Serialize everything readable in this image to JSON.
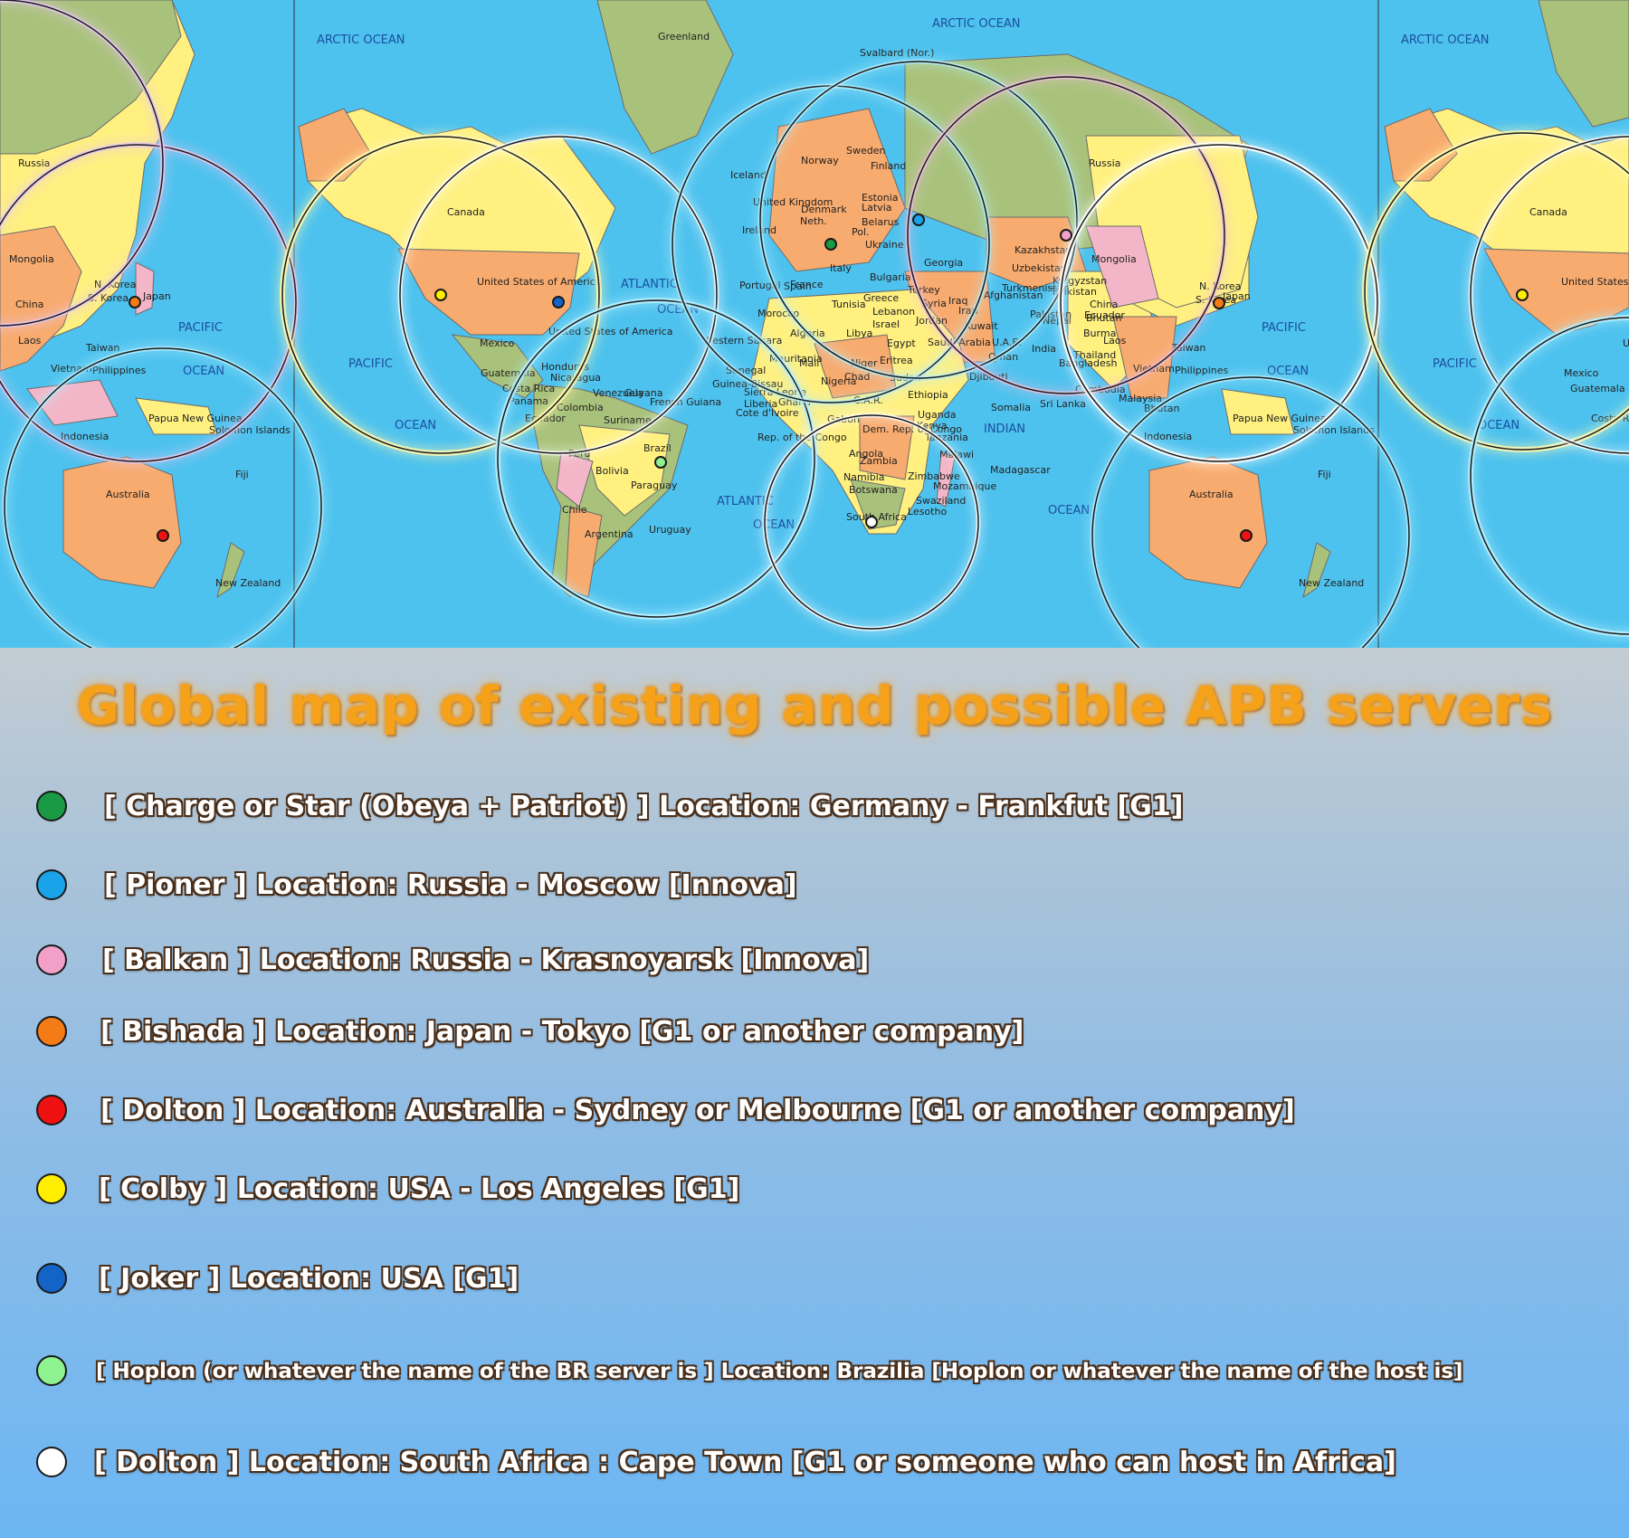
{
  "title": "Global map of existing and possible APB servers",
  "colors": {
    "ocean": "#4ec2ee",
    "land_green": "#a9c27b",
    "land_yellow": "#fff080",
    "land_orange": "#f8ab6e",
    "land_pink": "#f3b6c8",
    "range_ring": "#1a1a1a",
    "title": "#f5a21a"
  },
  "map": {
    "ocean_labels": [
      "ARCTIC OCEAN",
      "ARCTIC OCEAN",
      "ARCTIC OCEAN",
      "PACIFIC",
      "OCEAN",
      "PACIFIC",
      "OCEAN",
      "ATLANTIC",
      "OCEAN",
      "ATLANTIC",
      "OCEAN",
      "INDIAN",
      "OCEAN",
      "PACIFIC",
      "OCEAN",
      "PACIFIC",
      "OCEAN"
    ],
    "country_labels": [
      "Greenland",
      "Svalbard (Nor.)",
      "Russia",
      "Russia",
      "Mongolia",
      "China",
      "N. Korea",
      "S. Korea",
      "Japan",
      "Taiwan",
      "Laos",
      "Vietnam",
      "Philippines",
      "Papua New Guinea",
      "Solomon Islands",
      "Indonesia",
      "Australia",
      "New Zealand",
      "Fiji",
      "United States of America",
      "Canada",
      "United States of America",
      "Mexico",
      "Guatemala",
      "Honduras",
      "Nicaragua",
      "Costa Rica",
      "Panama",
      "Ecuador",
      "Colombia",
      "Venezuela",
      "Guyana",
      "Suriname",
      "French Guiana",
      "Peru",
      "Brazil",
      "Bolivia",
      "Paraguay",
      "Chile",
      "Argentina",
      "Uruguay",
      "Iceland",
      "United Kingdom",
      "Ireland",
      "Norway",
      "Sweden",
      "Finland",
      "Denmark",
      "Neth.",
      "Pol.",
      "Estonia",
      "Latvia",
      "Belarus",
      "Ukraine",
      "France",
      "Spain",
      "Portugal",
      "Italy",
      "Morocco",
      "Algeria",
      "Tunisia",
      "Libya",
      "Egypt",
      "Greece",
      "Bulgaria",
      "Turkey",
      "Georgia",
      "Syria",
      "Israel",
      "Lebanon",
      "Jordan",
      "Iraq",
      "Iran",
      "Kuwait",
      "Saudi Arabia",
      "U.A.E.",
      "Oman",
      "Eritrea",
      "Djibouti",
      "Sudan",
      "Ethiopia",
      "Somalia",
      "Kenya",
      "Uganda",
      "Tanzania",
      "Malawi",
      "Zambia",
      "Angola",
      "Namibia",
      "Botswana",
      "Zimbabwe",
      "Mozambique",
      "Swaziland",
      "Lesotho",
      "South Africa",
      "Madagascar",
      "Dem. Rep. of Congo",
      "Gabon",
      "C.A.R.",
      "Chad",
      "Niger",
      "Nigeria",
      "Mali",
      "Mauritania",
      "Western Sahara",
      "Senegal",
      "Guinea-Bissau",
      "Sierra Leone",
      "Liberia",
      "Cote d'Ivoire",
      "Ghana",
      "Rep. of the Congo",
      "Kazakhstan",
      "Kyrgyzstan",
      "Tajikistan",
      "Uzbekistan",
      "Turkmenistan",
      "Afghanistan",
      "Pakistan",
      "India",
      "Nepal",
      "Bangladesh",
      "Bhutan",
      "Burma",
      "Thailand",
      "Cambodia",
      "Malaysia",
      "Sri Lanka",
      "Mongolia",
      "China",
      "N. Korea",
      "S. Korea",
      "Japan",
      "Taiwan",
      "Laos",
      "Vietnam",
      "Philippines",
      "Papua New Guinea",
      "Solomon Islands",
      "Indonesia",
      "Australia",
      "New Zealand",
      "Fiji",
      "United States of America",
      "Canada",
      "United States of America",
      "Mexico",
      "Guatemala",
      "Costa Rica",
      "Ecuador",
      "Bhutan",
      "Malaysia"
    ]
  },
  "servers": [
    {
      "color": "#1a9a45",
      "label": "[ Charge or Star (Obeya + Patriot) ] Location: Germany - Frankfut [G1]"
    },
    {
      "color": "#1aa3e8",
      "label": "[ Pioner ] Location:  Russia - Moscow [Innova]"
    },
    {
      "color": "#f2a0c8",
      "label": "[ Balkan ] Location:  Russia - Krasnoyarsk [Innova]"
    },
    {
      "color": "#f47b16",
      "label": "[ Bishada ] Location:  Japan - Tokyo [G1 or another company]"
    },
    {
      "color": "#ee1111",
      "label": "[ Dolton ] Location:  Australia - Sydney or  Melbourne [G1 or another company]"
    },
    {
      "color": "#ffee00",
      "label": "[ Colby ] Location:  USA - Los Angeles [G1]"
    },
    {
      "color": "#1464c8",
      "label": "[ Joker ] Location:  USA [G1]"
    },
    {
      "color": "#8ef28e",
      "label": "[ Hoplon (or whatever the name of the BR server is ] Location:  Brazilia [Hoplon or whatever the name of the host is]"
    },
    {
      "color": "#ffffff",
      "label": "[ Dolton ] Location:  South Africa : Cape Town [G1 or someone who can host in Africa]"
    }
  ]
}
